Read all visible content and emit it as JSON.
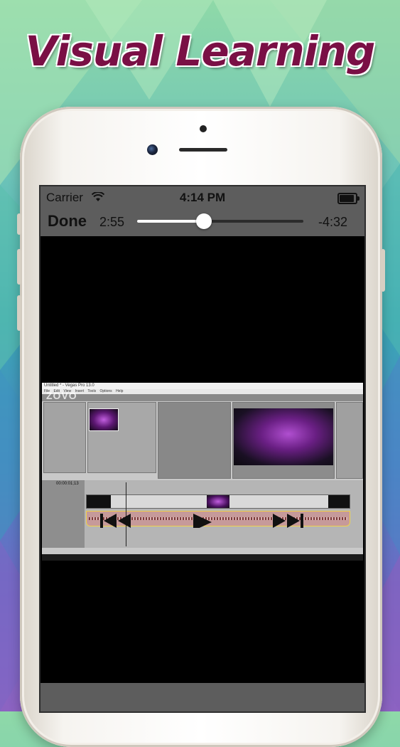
{
  "promo": {
    "headline": "Visual Learning"
  },
  "status_bar": {
    "carrier": "Carrier",
    "time": "4:14 PM"
  },
  "player": {
    "done_label": "Done",
    "elapsed": "2:55",
    "remaining": "-4:32",
    "progress_fraction": 0.4
  },
  "video_frame": {
    "watermark": "ZOVO",
    "window_title": "Untitled * - Vegas Pro 13.0",
    "menu": "File Edit View Insert Tools Options Help",
    "timecode": "00:00:01;13"
  },
  "controls": {
    "previous": "previous-track",
    "play": "play",
    "next": "next-track"
  }
}
